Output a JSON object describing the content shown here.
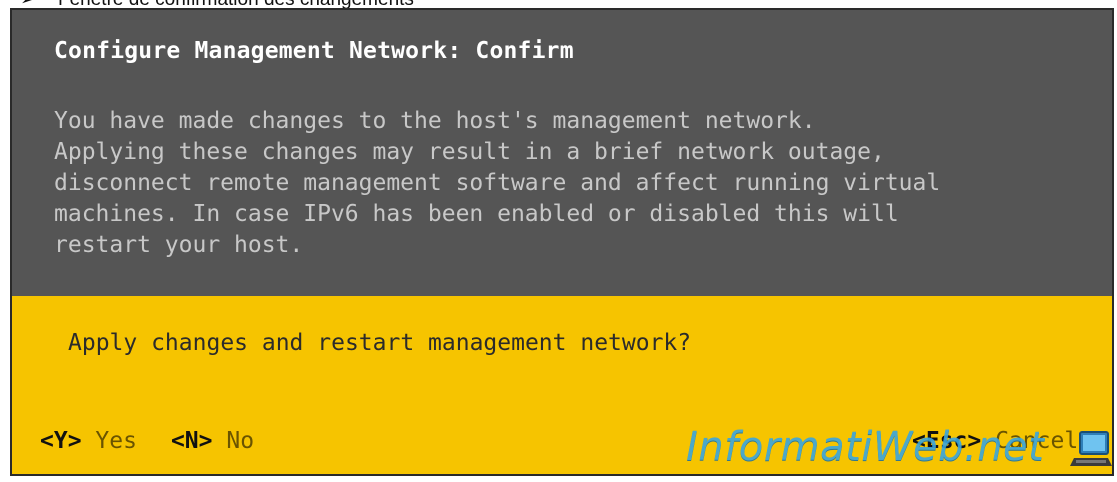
{
  "caption": {
    "bullet": "➢",
    "text": "Fenêtre de confirmation des changements"
  },
  "dialog": {
    "title": "Configure Management Network: Confirm",
    "message_lines": [
      "You have made changes to the host's management network.",
      "Applying these changes may result in a brief network outage,",
      "disconnect remote management software and affect running virtual",
      "machines. In case IPv6 has been enabled or disabled this will",
      "restart your host."
    ],
    "question": "Apply changes and restart management network?",
    "actions": {
      "yes": {
        "key": "<Y>",
        "label": "Yes"
      },
      "no": {
        "key": "<N>",
        "label": "No"
      },
      "cancel": {
        "key": "<Esc>",
        "label": "Cancel"
      }
    }
  },
  "watermark": {
    "text": "InformatiWeb.net",
    "icon": "laptop-icon"
  },
  "colors": {
    "top_panel": "#555555",
    "bottom_panel": "#f6c400",
    "title_text": "#ffffff",
    "message_text": "#c8c8c8",
    "watermark": "#3aa6df"
  }
}
